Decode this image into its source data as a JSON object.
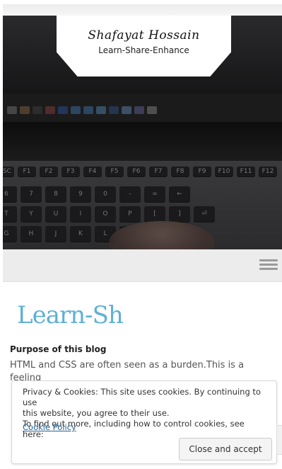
{
  "site": {
    "title": "Shafayat Hossain",
    "tagline": "Learn-Share-Enhance"
  },
  "post": {
    "heading": "Learn-Sh",
    "subtitle": "Purpose of this blog",
    "first_line": "HTML and CSS are often seen as a burden.This is a feeling"
  },
  "keyboard_keys": {
    "row1": [
      "ESC",
      "F1",
      "F2",
      "F3",
      "F4",
      "F5",
      "F6",
      "F7",
      "F8",
      "F9",
      "F10",
      "F11",
      "F12"
    ],
    "row2": [
      "6",
      "7",
      "8",
      "9",
      "0",
      "-",
      "=",
      "←"
    ],
    "row3": [
      "T",
      "Y",
      "U",
      "I",
      "O",
      "P",
      "[",
      "]",
      "⏎"
    ],
    "row4": [
      "G",
      "H",
      "J",
      "K",
      "L",
      ";",
      "'",
      "\\"
    ]
  },
  "cookie": {
    "text_line1": "Privacy & Cookies: This site uses cookies. By continuing to use",
    "text_line2": "this website, you agree to their use.",
    "text_line3": "To find out more, including how to control cookies, see here:",
    "link": "Cookie Policy",
    "button": "Close and accept"
  },
  "colors": {
    "heading_accent": "#5fb0d6",
    "link": "#2a6496"
  }
}
